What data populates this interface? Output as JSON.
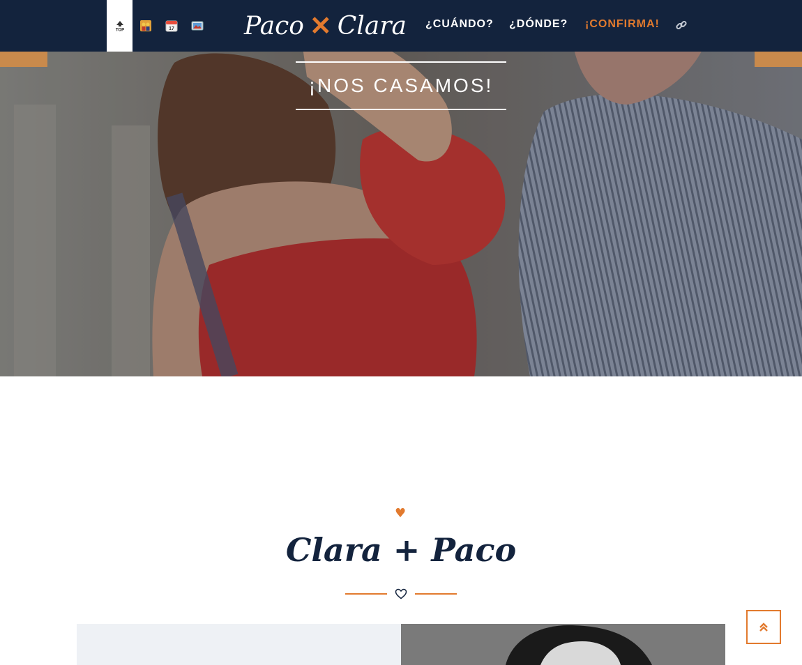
{
  "colors": {
    "navy": "#13233d",
    "accent": "#e27a2e",
    "white": "#ffffff"
  },
  "navbar": {
    "emoji_tabs": [
      {
        "name": "top",
        "icon": "top-arrow-emoji",
        "label": "TOP",
        "active": true
      },
      {
        "name": "couple",
        "icon": "couple-emoji",
        "active": false
      },
      {
        "name": "calendar",
        "icon": "calendar-emoji",
        "label": "17",
        "active": false
      },
      {
        "name": "photo",
        "icon": "picture-emoji",
        "active": false
      }
    ],
    "logo": {
      "left": "Paco",
      "separator": "✕",
      "right": "Clara"
    },
    "links": [
      {
        "label": "¿CUÁNDO?",
        "accent": false
      },
      {
        "label": "¿DÓNDE?",
        "accent": false
      },
      {
        "label": "¡CONFIRMA!",
        "accent": true
      }
    ],
    "link_icon": "link-icon"
  },
  "hero": {
    "headline": "¡NOS CASAMOS!"
  },
  "couple": {
    "title": "Clara + Paco",
    "top_icon": "heart-filled-icon",
    "divider_icon": "heart-outline-icon"
  },
  "back_to_top_icon": "double-chevron-up-icon"
}
